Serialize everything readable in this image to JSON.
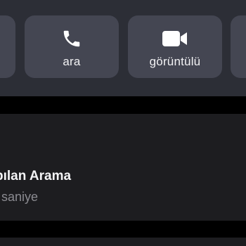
{
  "actions": {
    "call": {
      "label": "ara",
      "icon": "phone-icon"
    },
    "video": {
      "label": "görüntülü",
      "icon": "video-camera-icon"
    }
  },
  "call_info": {
    "title": "pılan Arama",
    "duration": "saniye"
  },
  "colors": {
    "panel": "#2c2e36",
    "button": "#444652",
    "info_panel": "#1d1d20",
    "primary_text": "#f4f4f6",
    "secondary_text": "#8b8b91"
  }
}
